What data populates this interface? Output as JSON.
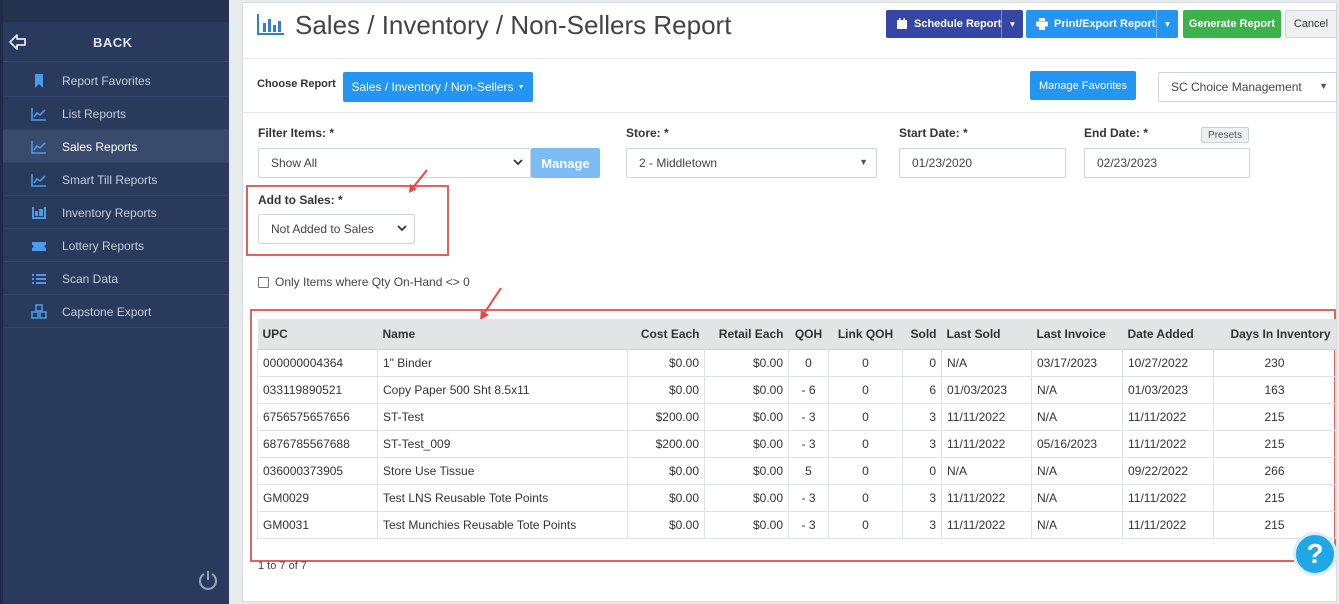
{
  "sidebar": {
    "back_label": "BACK",
    "items": [
      {
        "label": "Report Favorites",
        "icon": "bookmark-icon"
      },
      {
        "label": "List Reports",
        "icon": "line-chart-icon"
      },
      {
        "label": "Sales Reports",
        "icon": "line-chart-icon",
        "active": true
      },
      {
        "label": "Smart Till Reports",
        "icon": "line-chart-icon"
      },
      {
        "label": "Inventory Reports",
        "icon": "inventory-icon"
      },
      {
        "label": "Lottery Reports",
        "icon": "ticket-icon"
      },
      {
        "label": "Scan Data",
        "icon": "list-icon"
      },
      {
        "label": "Capstone Export",
        "icon": "boxes-icon"
      }
    ]
  },
  "header": {
    "title": "Sales / Inventory / Non-Sellers Report",
    "schedule_label": "Schedule Report",
    "print_label": "Print/Export Report",
    "generate_label": "Generate Report",
    "cancel_label": "Cancel"
  },
  "controls": {
    "choose_report_label": "Choose Report",
    "choose_report_value": "Sales / Inventory / Non-Sellers",
    "manage_favorites_label": "Manage Favorites",
    "organization_value": "SC Choice Management",
    "filter_items_label": "Filter Items: *",
    "filter_items_value": "Show All",
    "manage_label": "Manage",
    "store_label": "Store: *",
    "store_value": "2 - Middletown",
    "start_date_label": "Start Date: *",
    "start_date_value": "01/23/2020",
    "end_date_label": "End Date: *",
    "end_date_value": "02/23/2023",
    "presets_label": "Presets",
    "add_to_sales_label": "Add to Sales: *",
    "add_to_sales_value": "Not Added to Sales",
    "qty_checkbox_label": "Only Items where Qty On-Hand <> 0"
  },
  "table": {
    "columns": [
      "UPC",
      "Name",
      "Cost Each",
      "Retail Each",
      "QOH",
      "Link QOH",
      "Sold",
      "Last Sold",
      "Last Invoice",
      "Date Added",
      "Days In Inventory"
    ],
    "rows": [
      [
        "000000004364",
        "1\" Binder",
        "$0.00",
        "$0.00",
        "0",
        "0",
        "0",
        "N/A",
        "03/17/2023",
        "10/27/2022",
        "230"
      ],
      [
        "033119890521",
        "Copy Paper 500 Sht 8.5x11",
        "$0.00",
        "$0.00",
        "- 6",
        "0",
        "6",
        "01/03/2023",
        "N/A",
        "01/03/2023",
        "163"
      ],
      [
        "6756575657656",
        "ST-Test",
        "$200.00",
        "$0.00",
        "- 3",
        "0",
        "3",
        "11/11/2022",
        "N/A",
        "11/11/2022",
        "215"
      ],
      [
        "6876785567688",
        "ST-Test_009",
        "$200.00",
        "$0.00",
        "- 3",
        "0",
        "3",
        "11/11/2022",
        "05/16/2023",
        "11/11/2022",
        "215"
      ],
      [
        "036000373905",
        "Store Use Tissue",
        "$0.00",
        "$0.00",
        "5",
        "0",
        "0",
        "N/A",
        "N/A",
        "09/22/2022",
        "266"
      ],
      [
        "GM0029",
        "Test LNS Reusable Tote Points",
        "$0.00",
        "$0.00",
        "- 3",
        "0",
        "3",
        "11/11/2022",
        "N/A",
        "11/11/2022",
        "215"
      ],
      [
        "GM0031",
        "Test Munchies Reusable Tote Points",
        "$0.00",
        "$0.00",
        "- 3",
        "0",
        "3",
        "11/11/2022",
        "N/A",
        "11/11/2022",
        "215"
      ]
    ],
    "pager": "1 to 7 of 7"
  },
  "help_label": "?",
  "colors": {
    "sidebar_bg": "#2a3a5c",
    "accent_blue": "#2495f0",
    "schedule_blue": "#3546a5",
    "generate_green": "#3cb34a",
    "highlight_red": "#e26262"
  }
}
